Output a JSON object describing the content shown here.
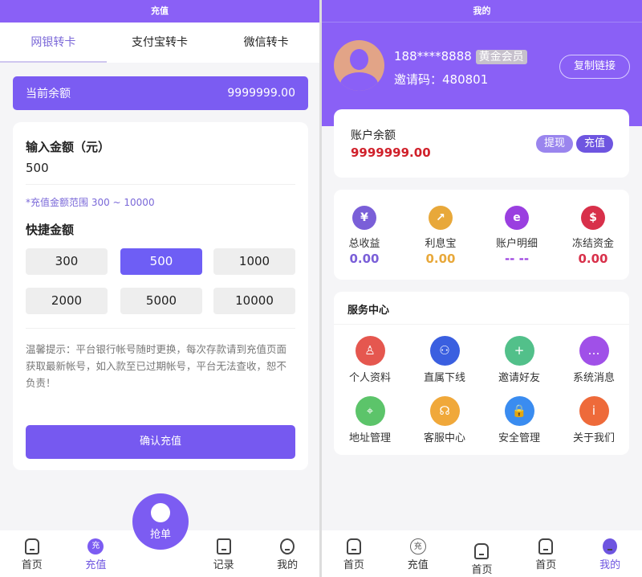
{
  "left": {
    "title": "充值",
    "tabs": [
      {
        "label": "网银转卡"
      },
      {
        "label": "支付宝转卡"
      },
      {
        "label": "微信转卡"
      }
    ],
    "balance": {
      "label": "当前余额",
      "value": "9999999.00"
    },
    "input": {
      "label": "输入金额（元）",
      "value": "500",
      "hint": "*充值金额范围 300 ~ 10000"
    },
    "quick": {
      "label": "快捷金额",
      "options": [
        "300",
        "500",
        "1000",
        "2000",
        "5000",
        "10000"
      ],
      "selected": "500"
    },
    "tip": "温馨提示：平台银行帐号随时更换，每次存款请到充值页面获取最新帐号，如入款至已过期帐号，平台无法查收，恕不负责！",
    "confirm": "确认充值",
    "nav": [
      {
        "label": "首页",
        "icon": "home-icon"
      },
      {
        "label": "充值",
        "icon": "recharge-icon"
      },
      {
        "label": "抢单",
        "icon": "grab-order-icon"
      },
      {
        "label": "记录",
        "icon": "record-icon"
      },
      {
        "label": "我的",
        "icon": "profile-icon"
      }
    ]
  },
  "right": {
    "title": "我的",
    "user": {
      "phone": "188****8888",
      "level": "黄金会员",
      "invite": "邀请码：480801",
      "copy": "复制链接"
    },
    "account": {
      "label": "账户余额",
      "value": "9999999.00",
      "withdraw": "提现",
      "recharge": "充值"
    },
    "stats": [
      {
        "label": "总收益",
        "value": "0.00",
        "color": "#7a5fd8",
        "icon": "money-bag-icon",
        "glyph": "¥"
      },
      {
        "label": "利息宝",
        "value": "0.00",
        "color": "#e8a83a",
        "icon": "trend-chart-icon",
        "glyph": "↗"
      },
      {
        "label": "账户明细",
        "value": "-- --",
        "color": "#9a3fe0",
        "icon": "account-detail-icon",
        "glyph": "e"
      },
      {
        "label": "冻结资金",
        "value": "0.00",
        "color": "#d8304a",
        "icon": "frozen-funds-icon",
        "glyph": "$"
      }
    ],
    "service": {
      "title": "服务中心",
      "items": [
        {
          "label": "个人资料",
          "icon": "user-icon",
          "color": "#e5574f",
          "glyph": "♙"
        },
        {
          "label": "直属下线",
          "icon": "org-chart-icon",
          "color": "#3a5fe0",
          "glyph": "⚇"
        },
        {
          "label": "邀请好友",
          "icon": "add-user-icon",
          "color": "#52c08a",
          "glyph": "+"
        },
        {
          "label": "系统消息",
          "icon": "message-icon",
          "color": "#a050e8",
          "glyph": "…"
        },
        {
          "label": "地址管理",
          "icon": "location-icon",
          "color": "#5cc46a",
          "glyph": "⌖"
        },
        {
          "label": "客服中心",
          "icon": "customer-service-icon",
          "color": "#f0a83a",
          "glyph": "☊"
        },
        {
          "label": "安全管理",
          "icon": "lock-icon",
          "color": "#3a8cf0",
          "glyph": "🔒"
        },
        {
          "label": "关于我们",
          "icon": "info-icon",
          "color": "#ee6a3a",
          "glyph": "i"
        }
      ]
    },
    "nav": [
      {
        "label": "首页"
      },
      {
        "label": "充值"
      },
      {
        "label": "首页"
      },
      {
        "label": "首页"
      },
      {
        "label": "我的"
      }
    ]
  }
}
